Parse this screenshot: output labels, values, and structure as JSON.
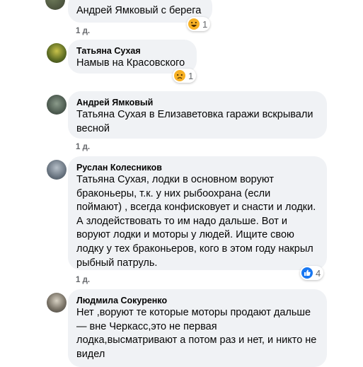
{
  "comments": [
    {
      "author": "",
      "text": "Андрей Ямковый с берега",
      "time": "1 д.",
      "reaction": {
        "icon": "haha-emoji-icon",
        "count": "1"
      }
    },
    {
      "author": "Татьяна Сухая",
      "text": "Намыв на Красовского",
      "reaction": {
        "icon": "sad-emoji-icon",
        "count": "1"
      }
    },
    {
      "author": "Андрей Ямковый",
      "text": "Татьяна Сухая в Елизаветовка гаражи вскрывали весной",
      "time": "1 д."
    },
    {
      "author": "Руслан Колесников",
      "text": "Татьяна Сухая, лодки в основном воруют браконьеры, т.к. у них рыбоохрана (если поймают) , всегда конфисковует и снасти и лодки. А злодействовать то им надо дальше. Вот и воруют лодки и моторы у людей. Ищите свою лодку у тех браконьеров, кого в этом году накрыл рыбный патруль.",
      "time": "1 д.",
      "reaction": {
        "icon": "like-icon",
        "count": "4"
      }
    },
    {
      "author": "Людмила Сокуренко",
      "text": "Нет ,воруют те которые моторы продают дальше — вне Черкасс,это не первая лодка,высматривают а потом раз и нет, и никто не видел"
    }
  ],
  "colors": {
    "bubble": "#f0f2f5",
    "meta": "#65676b",
    "like": "#1877f2",
    "emoji": "#f7b125"
  }
}
